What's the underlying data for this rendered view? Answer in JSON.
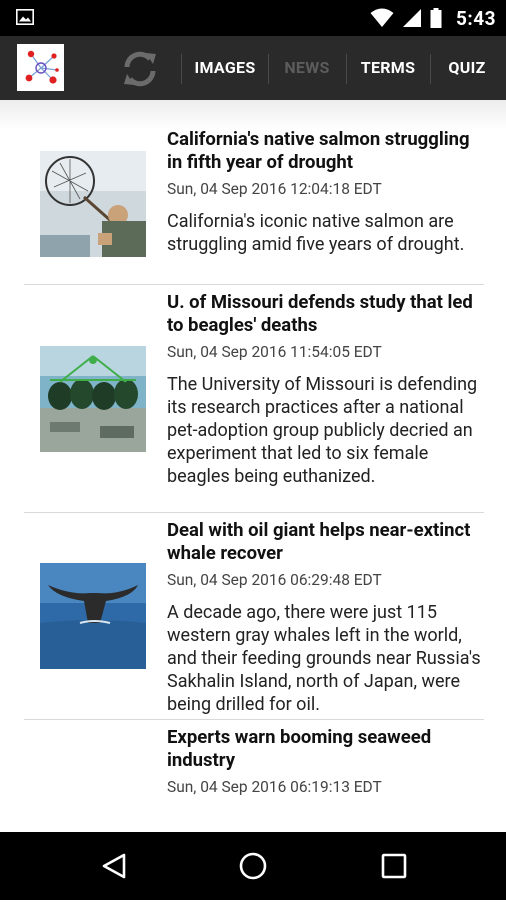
{
  "status_bar": {
    "time": "5:43",
    "icons": [
      "image-icon",
      "wifi-icon",
      "signal-icon",
      "battery-icon"
    ]
  },
  "action_bar": {
    "logo_icon": "app-logo-icon",
    "refresh_icon": "refresh-icon",
    "tabs": [
      {
        "label": "IMAGES",
        "active": true
      },
      {
        "label": "NEWS",
        "active": false
      },
      {
        "label": "TERMS",
        "active": true
      },
      {
        "label": "QUIZ",
        "active": true
      }
    ]
  },
  "articles": [
    {
      "title": "California's native salmon struggling in fifth year of drought",
      "date": "Sun, 04 Sep 2016 12:04:18 EDT",
      "summary": "California's iconic native salmon are struggling amid five years of drought.",
      "thumbnail": "fisherman-net-photo"
    },
    {
      "title": "U. of Missouri defends study that led to beagles' deaths",
      "date": "Sun, 04 Sep 2016 11:54:05 EDT",
      "summary": "The University of Missouri is defending its research practices after a national pet-adoption group publicly decried an experiment that led to six female beagles being euthanized.",
      "thumbnail": "fishing-buoys-photo"
    },
    {
      "title": "Deal with oil giant helps near-extinct whale recover",
      "date": "Sun, 04 Sep 2016 06:29:48 EDT",
      "summary": "A decade ago, there were just 115 western gray whales left in the world, and their feeding grounds near Russia's Sakhalin Island, north of Japan, were being drilled for oil.",
      "thumbnail": "whale-tail-photo"
    },
    {
      "title": "Experts warn booming seaweed industry",
      "date": "Sun, 04 Sep 2016 06:19:13 EDT",
      "summary": "",
      "thumbnail": ""
    }
  ],
  "nav_bar": {
    "icons": [
      "back-icon",
      "home-icon",
      "recents-icon"
    ]
  }
}
